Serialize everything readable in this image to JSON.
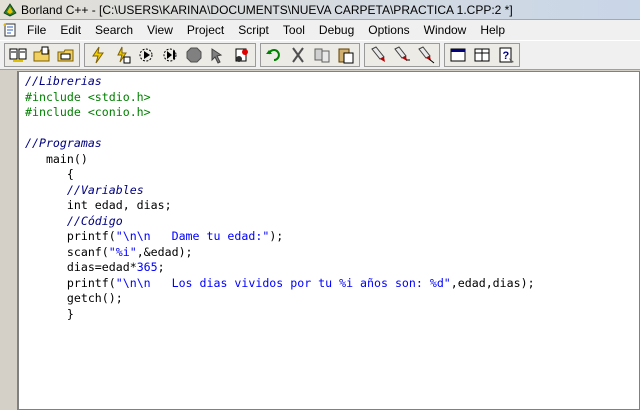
{
  "window": {
    "title": "Borland C++ - [C:\\USERS\\KARINA\\DOCUMENTS\\NUEVA CARPETA\\PRACTICA 1.CPP:2 *]"
  },
  "menu": {
    "items": [
      "File",
      "Edit",
      "Search",
      "View",
      "Project",
      "Script",
      "Tool",
      "Debug",
      "Options",
      "Window",
      "Help"
    ]
  },
  "toolbar": {
    "icons": [
      "open-project-icon",
      "open-file-icon",
      "save-file-icon",
      "make-icon",
      "compile-icon",
      "debug-icon",
      "step-icon",
      "stop-icon",
      "pointer-icon",
      "breakpoint-icon",
      "undo-icon",
      "cut-icon",
      "copy-icon",
      "paste-icon",
      "marker-icon",
      "marker-add-icon",
      "marker-remove-icon",
      "window-icon",
      "tile-icon",
      "help-icon"
    ]
  },
  "editor": {
    "lines": [
      [
        {
          "t": "//Librerias",
          "c": "comment"
        }
      ],
      [
        {
          "t": "#include <stdio.h>",
          "c": "pp"
        }
      ],
      [
        {
          "t": "#include <conio.h>",
          "c": "pp"
        }
      ],
      [],
      [
        {
          "t": "//Programas",
          "c": "comment"
        }
      ],
      [
        {
          "t": "   main()",
          "c": ""
        }
      ],
      [
        {
          "t": "      {",
          "c": ""
        }
      ],
      [
        {
          "t": "      ",
          "c": ""
        },
        {
          "t": "//Variables",
          "c": "comment"
        }
      ],
      [
        {
          "t": "      int edad, dias;",
          "c": ""
        }
      ],
      [
        {
          "t": "      ",
          "c": ""
        },
        {
          "t": "//Código",
          "c": "comment"
        }
      ],
      [
        {
          "t": "      printf(",
          "c": ""
        },
        {
          "t": "\"\\n\\n   Dame tu edad:\"",
          "c": "str"
        },
        {
          "t": ");",
          "c": ""
        }
      ],
      [
        {
          "t": "      scanf(",
          "c": ""
        },
        {
          "t": "\"%i\"",
          "c": "str"
        },
        {
          "t": ",&edad);",
          "c": ""
        }
      ],
      [
        {
          "t": "      dias=edad*",
          "c": ""
        },
        {
          "t": "365",
          "c": "num"
        },
        {
          "t": ";",
          "c": ""
        }
      ],
      [
        {
          "t": "      printf(",
          "c": ""
        },
        {
          "t": "\"\\n\\n   Los dias vividos por tu %i años son: %d\"",
          "c": "str"
        },
        {
          "t": ",edad,dias);",
          "c": ""
        }
      ],
      [
        {
          "t": "      getch();",
          "c": ""
        }
      ],
      [
        {
          "t": "      }",
          "c": ""
        }
      ]
    ]
  }
}
